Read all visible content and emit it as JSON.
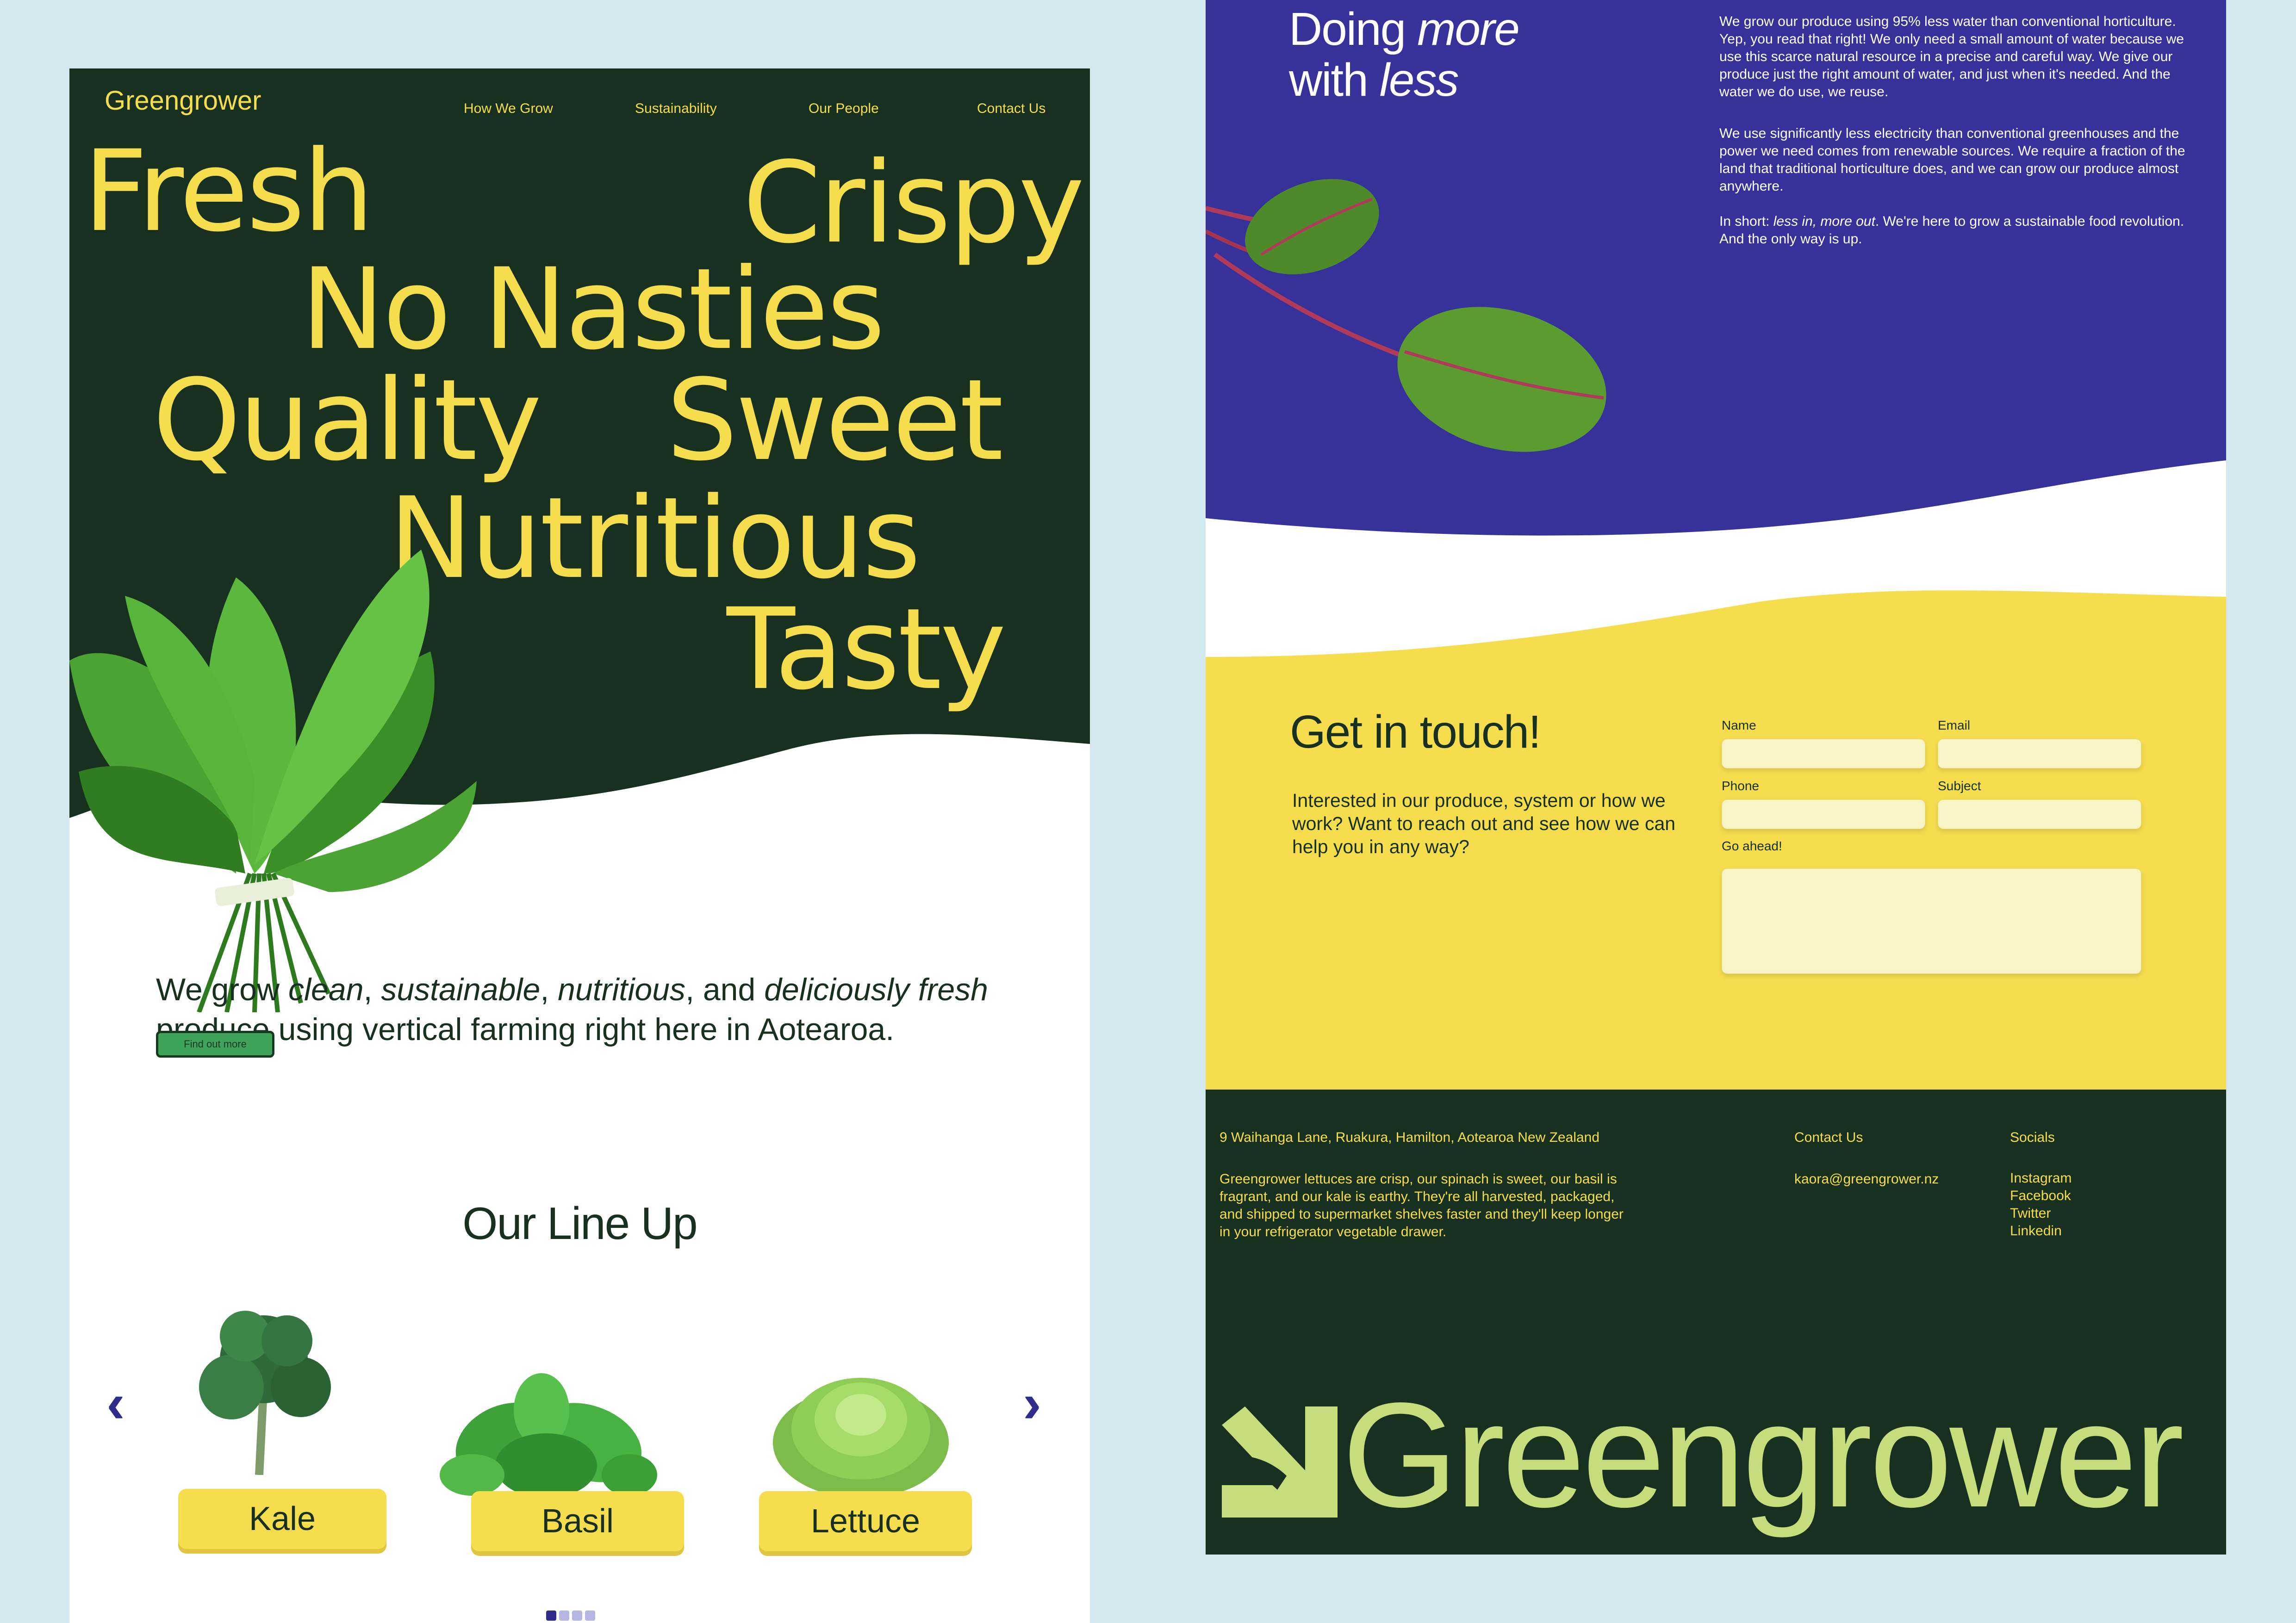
{
  "colors": {
    "background": "#d3e9ef",
    "dark_green": "#173020",
    "yellow": "#f5dd4e",
    "purple": "#36329a",
    "button_green": "#3fa45a",
    "lime": "#c6dd7d",
    "input_fill": "#f8f4c6"
  },
  "nav": {
    "brand": "Greengrower",
    "links": [
      "How We Grow",
      "Sustainability",
      "Our People",
      "Contact Us"
    ]
  },
  "hero": {
    "words": [
      "Fresh",
      "Crispy",
      "No Nasties",
      "Quality",
      "Sweet",
      "Nutritious",
      "Tasty"
    ],
    "image": "spinach-bunch"
  },
  "intro": {
    "parts": [
      "We grow ",
      "clean",
      ", ",
      "sustainable",
      ", ",
      "nutritious",
      ", and ",
      "deliciously fresh",
      " produce using vertical farming right here in Aotearoa."
    ],
    "button": "Find out more"
  },
  "lineup": {
    "title": "Our Line Up",
    "prev_icon": "chevron-left-icon",
    "next_icon": "chevron-right-icon",
    "products": [
      {
        "label": "Kale",
        "image": "kale"
      },
      {
        "label": "Basil",
        "image": "basil"
      },
      {
        "label": "Lettuce",
        "image": "lettuce"
      }
    ],
    "pager": {
      "count": 4,
      "active": 1
    }
  },
  "doing": {
    "title_1": "Doing ",
    "title_em_1": "more",
    "title_2": "with ",
    "title_em_2": "less",
    "para1": "We grow our produce using 95% less water than conventional horticulture. Yep, you read that right! We only need a small amount of water because we use this scarce natural resource in a precise and careful way. We give our produce just the right amount of water, and just when it's needed. And the water we do use, we reuse.",
    "para2": "We use significantly less electricity than conventional greenhouses and the power we need comes from renewable sources. We require a fraction of the land that traditional horticulture does, and we can grow our produce almost anywhere.",
    "para3_a": "In short: ",
    "para3_em": "less in, more out",
    "para3_b": ". We're here to grow a sustainable food revolution. And the only way is up.",
    "image": "chard-leaves"
  },
  "contact": {
    "title": "Get in touch!",
    "text": "Interested in our produce, system or how we work? Want to reach out and see how we can help you in any way?",
    "fields": {
      "name": "Name",
      "email": "Email",
      "phone": "Phone",
      "subject": "Subject",
      "message": "Go ahead!"
    }
  },
  "footer": {
    "address": "9 Waihanga Lane, Ruakura, Hamilton, Aotearoa New Zealand",
    "about": "Greengrower lettuces are crisp, our spinach is sweet, our basil is fragrant, and our kale is earthy. They're all harvested, packaged, and shipped to supermarket shelves faster and they'll keep longer in your refrigerator vegetable drawer.",
    "contact_heading": "Contact Us",
    "email": "kaora@greengrower.nz",
    "socials_heading": "Socials",
    "socials": [
      "Instagram",
      "Facebook",
      "Twitter",
      "Linkedin"
    ],
    "big_brand": "Greengrower",
    "logo_icon": "arrow-leaf-logo-icon"
  }
}
